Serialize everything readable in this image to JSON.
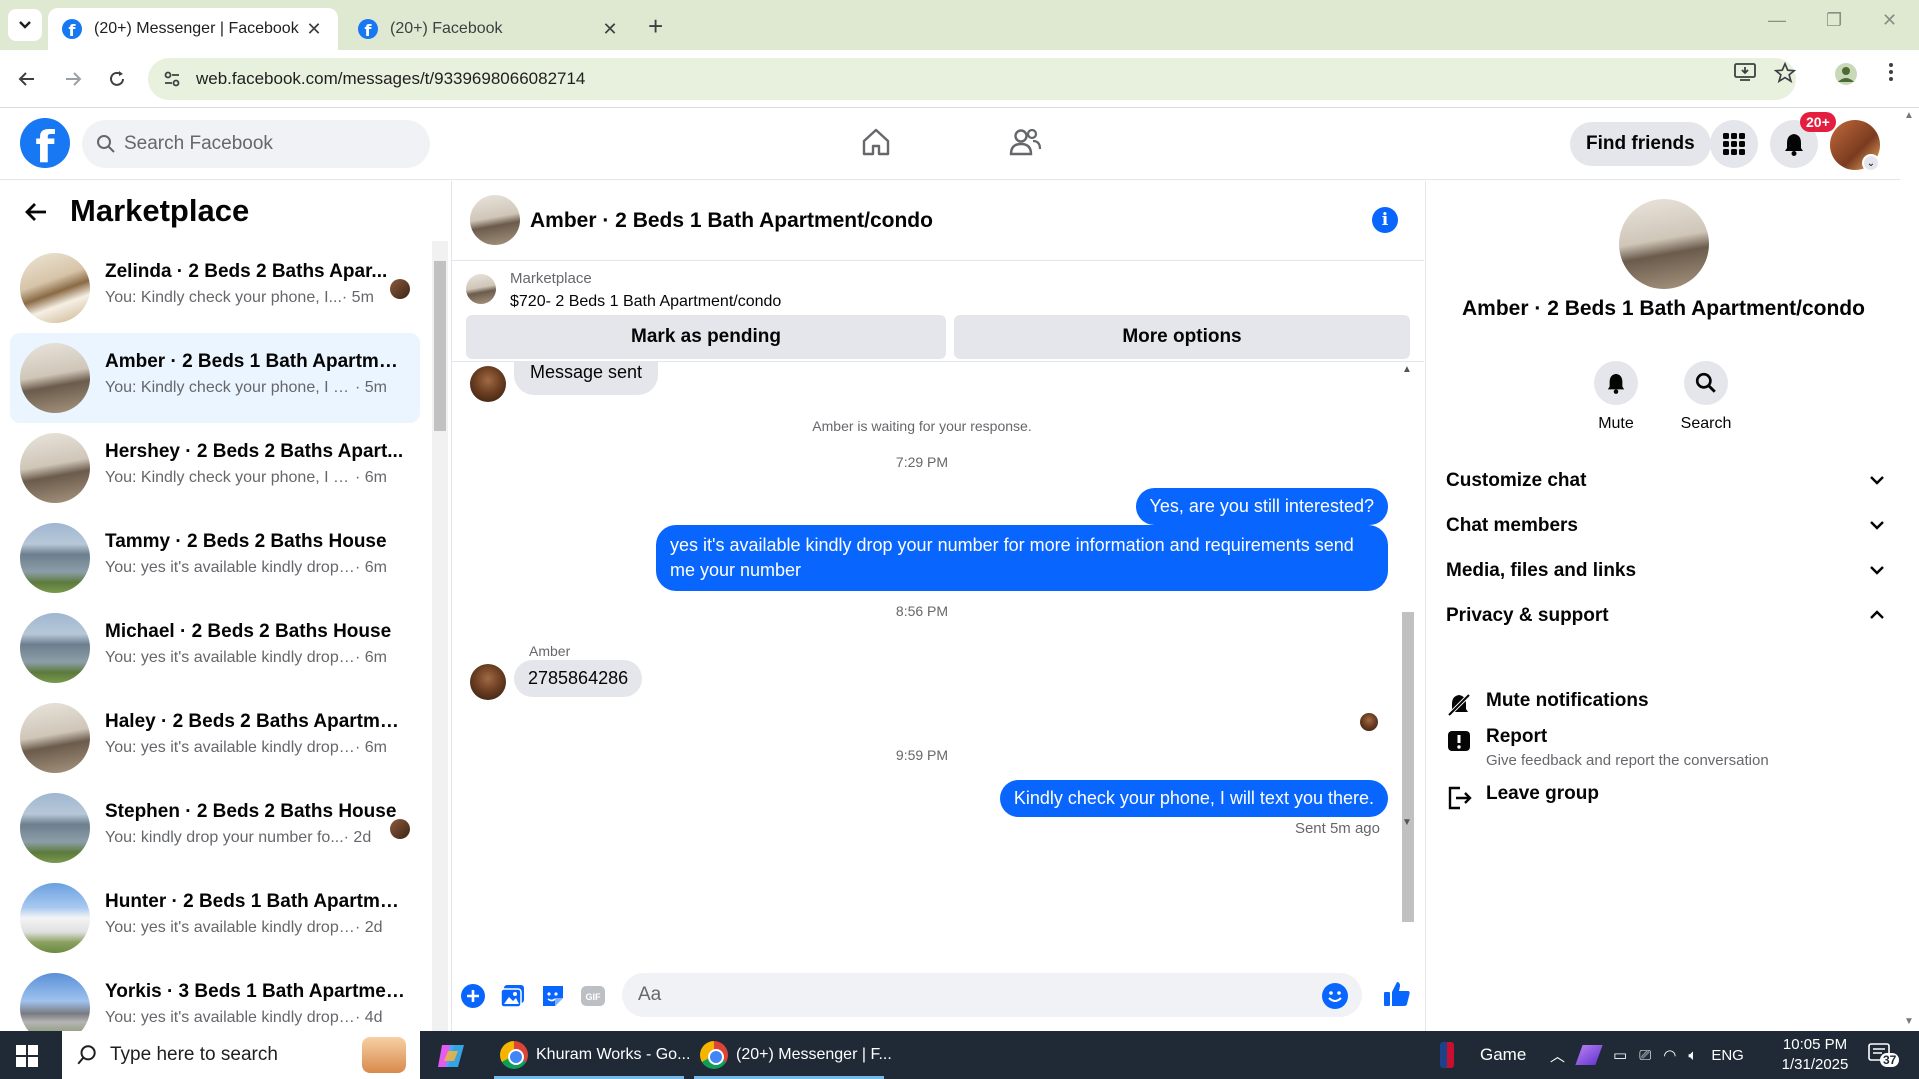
{
  "browser": {
    "tabs": [
      {
        "title": "(20+) Messenger | Facebook",
        "close": "✕",
        "active": true
      },
      {
        "title": "(20+) Facebook",
        "close": "✕",
        "active": false
      }
    ],
    "new_tab": "+",
    "url": "web.facebook.com/messages/t/9339698066082714"
  },
  "fb": {
    "search_placeholder": "Search Facebook",
    "find_friends": "Find friends",
    "notif_badge": "20+"
  },
  "sidebar": {
    "title": "Marketplace",
    "conversations": [
      {
        "name": "Zelinda · 2 Beds 2 Baths Apar...",
        "preview": "You: Kindly check your phone, I...",
        "time": "· 5m",
        "seen": true,
        "img": "img-kitchen"
      },
      {
        "name": "Amber · 2 Beds 1 Bath Apartme...",
        "preview": "You: Kindly check your phone, I wi...",
        "time": "· 5m",
        "seen": false,
        "img": "img-room",
        "active": true
      },
      {
        "name": "Hershey · 2 Beds 2 Baths Apart...",
        "preview": "You: Kindly check your phone, I wi...",
        "time": "· 6m",
        "seen": false,
        "img": "img-room"
      },
      {
        "name": "Tammy · 2 Beds 2 Baths House",
        "preview": "You: yes it's available kindly drop y...",
        "time": "· 6m",
        "seen": false,
        "img": "img-house"
      },
      {
        "name": "Michael · 2 Beds 2 Baths House",
        "preview": "You: yes it's available kindly drop y...",
        "time": "· 6m",
        "seen": false,
        "img": "img-house"
      },
      {
        "name": "Haley · 2 Beds 2 Baths Apartme...",
        "preview": "You: yes it's available kindly drop y...",
        "time": "· 6m",
        "seen": false,
        "img": "img-room"
      },
      {
        "name": "Stephen · 2 Beds 2 Baths House",
        "preview": "You: kindly drop your number fo...",
        "time": "· 2d",
        "seen": true,
        "img": "img-house"
      },
      {
        "name": "Hunter · 2 Beds 1 Bath Apartme...",
        "preview": "You: yes it's available kindly drop y...",
        "time": "· 2d",
        "seen": false,
        "img": "img-white-house"
      },
      {
        "name": "Yorkis · 3 Beds 1 Bath Apartmen...",
        "preview": "You: yes it's available kindly drop y...",
        "time": "· 4d",
        "seen": false,
        "img": "img-long"
      }
    ]
  },
  "chat": {
    "title": "Amber · 2 Beds 1 Bath Apartment/condo",
    "marketplace_label": "Marketplace",
    "listing": "$720- 2 Beds 1 Bath Apartment/condo",
    "mark_pending": "Mark as pending",
    "more_options": "More options",
    "messages": {
      "m1": "Message sent",
      "waiting": "Amber is waiting for your response.",
      "t1": "7:29 PM",
      "m2": "Yes, are you still interested?",
      "m3": "yes it's available kindly drop your number for more information and requirements send me your number",
      "t2": "8:56 PM",
      "sender": "Amber",
      "m4": "2785864286",
      "t3": "9:59 PM",
      "m5": "Kindly check your phone, I will text you there.",
      "status": "Sent 5m ago"
    },
    "input_placeholder": "Aa"
  },
  "info": {
    "title": "Amber · 2 Beds 1 Bath Apartment/condo",
    "mute": "Mute",
    "search": "Search",
    "sections": {
      "customize": "Customize chat",
      "members": "Chat members",
      "media": "Media, files and links",
      "privacy": "Privacy & support"
    },
    "options": {
      "mute_notifications": "Mute notifications",
      "report": "Report",
      "report_sub": "Give feedback and report the conversation",
      "leave": "Leave group"
    }
  },
  "taskbar": {
    "search_placeholder": "Type here to search",
    "app1": "Khuram Works - Go...",
    "app2": "(20+) Messenger | F...",
    "game": "Game",
    "lang": "ENG",
    "time": "10:05 PM",
    "date": "1/31/2025",
    "notif_count": "37"
  },
  "colors": {
    "fb_blue": "#0866ff",
    "brand_blue": "#1877f2",
    "badge_red": "#e41e3f",
    "chrome_tint": "#dfe9d2"
  }
}
